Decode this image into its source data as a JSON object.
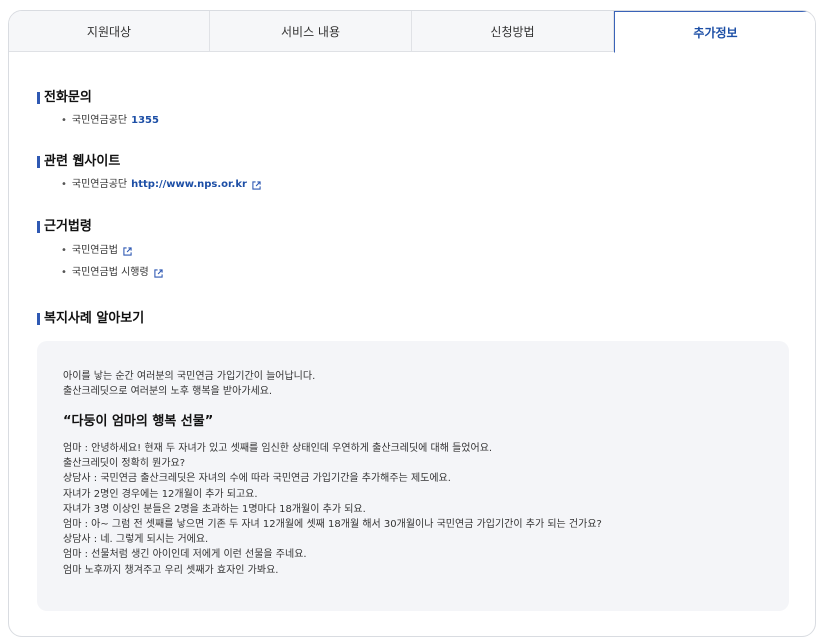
{
  "tabs": [
    {
      "label": "지원대상"
    },
    {
      "label": "서비스 내용"
    },
    {
      "label": "신청방법"
    },
    {
      "label": "추가정보"
    }
  ],
  "sections": {
    "phone": {
      "title": "전화문의",
      "items": [
        {
          "label": "국민연금공단",
          "value": "1355"
        }
      ]
    },
    "websites": {
      "title": "관련 웹사이트",
      "items": [
        {
          "label": "국민연금공단",
          "link": "http://www.nps.or.kr"
        }
      ]
    },
    "laws": {
      "title": "근거법령",
      "items": [
        {
          "label": "국민연금법"
        },
        {
          "label": "국민연금법 시행령"
        }
      ]
    },
    "case": {
      "title": "복지사례 알아보기",
      "intro": [
        "아이를 낳는 순간 여러분의 국민연금 가입기간이 늘어납니다.",
        "출산크레딧으로 여러분의 노후 행복을 받아가세요."
      ],
      "headline": "“다둥이 엄마의 행복 선물”",
      "dialog": [
        "엄마 : 안녕하세요! 현재 두 자녀가 있고 셋째를 임신한 상태인데 우연하게 출산크레딧에 대해 들었어요.",
        "출산크레딧이 정확히 뭔가요?",
        "상담사 : 국민연금 출산크레딧은 자녀의 수에 따라 국민연금 가입기간을 추가해주는 제도에요.",
        "자녀가 2명인 경우에는 12개월이 추가 되고요.",
        "자녀가 3명 이상인 분들은 2명을 초과하는 1명마다 18개월이 추가 되요.",
        "엄마 : 아~ 그럼 전 셋째를 낳으면 기존 두 자녀 12개월에 셋째 18개월 해서 30개월이나 국민연금 가입기간이 추가 되는 건가요?",
        "상담사 : 네. 그렇게 되시는 거에요.",
        "엄마 : 선물처럼 생긴 아이인데 저에게 이런 선물을 주네요.",
        "엄마 노후까지 챙겨주고 우리 셋째가 효자인 가봐요."
      ]
    }
  },
  "icons": {
    "external_link": "external-link-icon"
  },
  "colors": {
    "accent": "#2f59b3",
    "link": "#1d4fa6",
    "case_bg": "#f4f5f8"
  }
}
